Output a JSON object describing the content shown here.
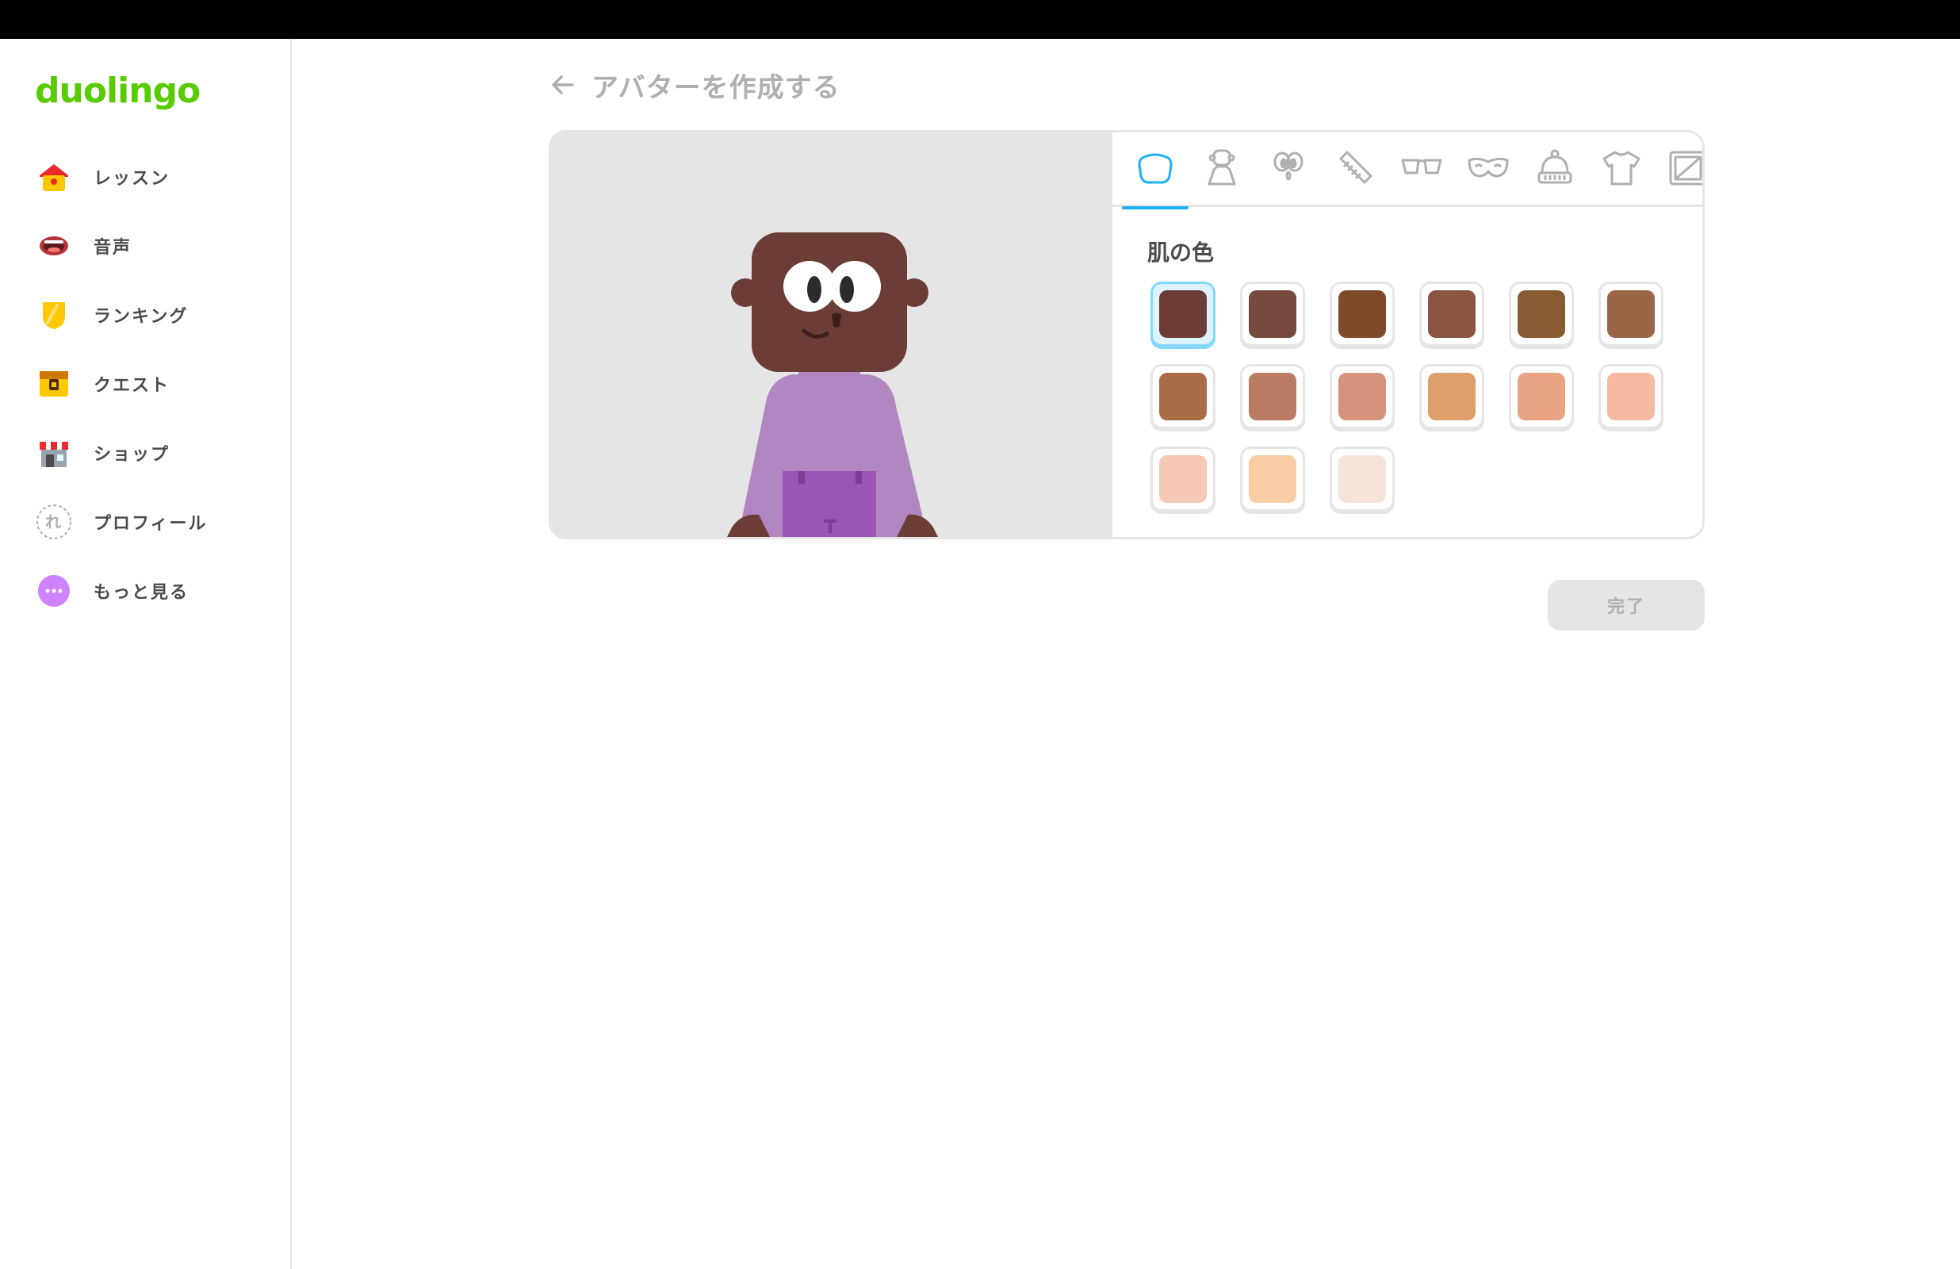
{
  "sidebar": {
    "logo": "duolingo",
    "items": [
      {
        "label": "レッスン",
        "icon": "home-icon"
      },
      {
        "label": "音声",
        "icon": "mouth-icon"
      },
      {
        "label": "ランキング",
        "icon": "shield-icon"
      },
      {
        "label": "クエスト",
        "icon": "treasure-chest-icon"
      },
      {
        "label": "ショップ",
        "icon": "shop-icon"
      },
      {
        "label": "プロフィール",
        "icon": "profile-avatar-icon"
      },
      {
        "label": "もっと見る",
        "icon": "more-icon"
      }
    ]
  },
  "header": {
    "title": "アバターを作成する",
    "back_icon": "back-arrow-icon"
  },
  "editor": {
    "tabs": [
      {
        "icon": "face-shape-icon",
        "active": true
      },
      {
        "icon": "body-icon",
        "active": false
      },
      {
        "icon": "eyes-icon",
        "active": false
      },
      {
        "icon": "comb-icon",
        "active": false
      },
      {
        "icon": "glasses-icon",
        "active": false
      },
      {
        "icon": "mask-icon",
        "active": false
      },
      {
        "icon": "hat-icon",
        "active": false
      },
      {
        "icon": "shirt-icon",
        "active": false
      },
      {
        "icon": "background-icon",
        "active": false
      }
    ],
    "section_title": "肌の色",
    "skin_colors": [
      "#6b3d36",
      "#754a3c",
      "#7f4a2a",
      "#8c5443",
      "#8a5a33",
      "#9b6548",
      "#a86d47",
      "#bb7a62",
      "#d4937a",
      "#de9f6c",
      "#e8a383",
      "#f5bba2",
      "#f5c7b6",
      "#f8cda4",
      "#f6e4db"
    ],
    "selected_index": 0
  },
  "footer": {
    "done_label": "完了"
  },
  "colors": {
    "brand_green": "#58cc02",
    "accent_blue": "#1cb0f6",
    "border": "#e5e5e5"
  }
}
